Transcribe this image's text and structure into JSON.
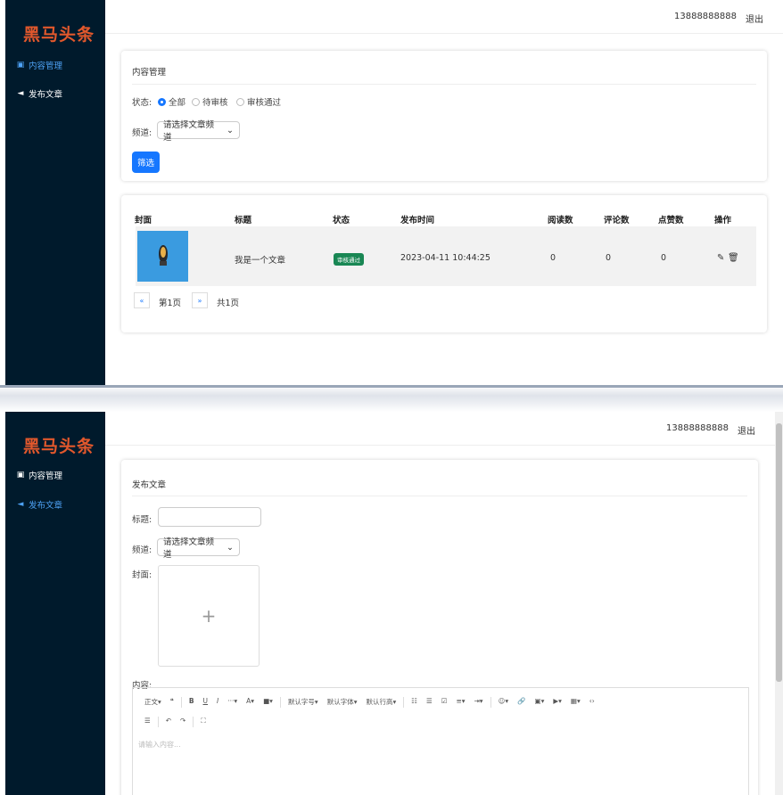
{
  "app": {
    "logo": "黑马头条",
    "user_phone": "13888888888",
    "logout": "退出"
  },
  "sidebar": {
    "items": [
      {
        "label": "内容管理",
        "icon": "document-icon"
      },
      {
        "label": "发布文章",
        "icon": "send-icon"
      }
    ]
  },
  "content_page": {
    "card_title": "内容管理",
    "status_label": "状态:",
    "status_options": [
      "全部",
      "待审核",
      "审核通过"
    ],
    "status_selected": "全部",
    "channel_label": "频道:",
    "channel_select": "请选择文章频道",
    "filter_button": "筛选",
    "table": {
      "headers": [
        "封面",
        "标题",
        "状态",
        "发布时间",
        "阅读数",
        "评论数",
        "点赞数",
        "操作"
      ],
      "rows": [
        {
          "title": "我是一个文章",
          "status": "审核通过",
          "time": "2023-04-11 10:44:25",
          "reads": "0",
          "comments": "0",
          "likes": "0"
        }
      ]
    },
    "pagination": {
      "prev": "«",
      "page": "第1页",
      "next": "»",
      "total": "共1页"
    },
    "colors": {
      "primary": "#1677ff",
      "badge": "#198754"
    }
  },
  "publish_page": {
    "card_title": "发布文章",
    "title_label": "标题:",
    "channel_label": "频道:",
    "channel_select": "请选择文章频道",
    "cover_label": "封面:",
    "cover_plus": "+",
    "content_label": "内容:",
    "toolbar_row1": [
      "正文▾",
      "❝",
      "B",
      "U",
      "I",
      "···▾",
      "A▾",
      "■▾",
      "默认字号▾",
      "默认字体▾",
      "默认行高▾",
      "☷",
      "☰",
      "☑",
      "≡▾",
      "⇥▾",
      "☺▾",
      "🔗",
      "▣▾",
      "▶▾",
      "▦▾",
      "‹›"
    ],
    "toolbar_row2": [
      "☰",
      "↶",
      "↷",
      "⛶"
    ],
    "content_placeholder": "请输入内容..."
  }
}
